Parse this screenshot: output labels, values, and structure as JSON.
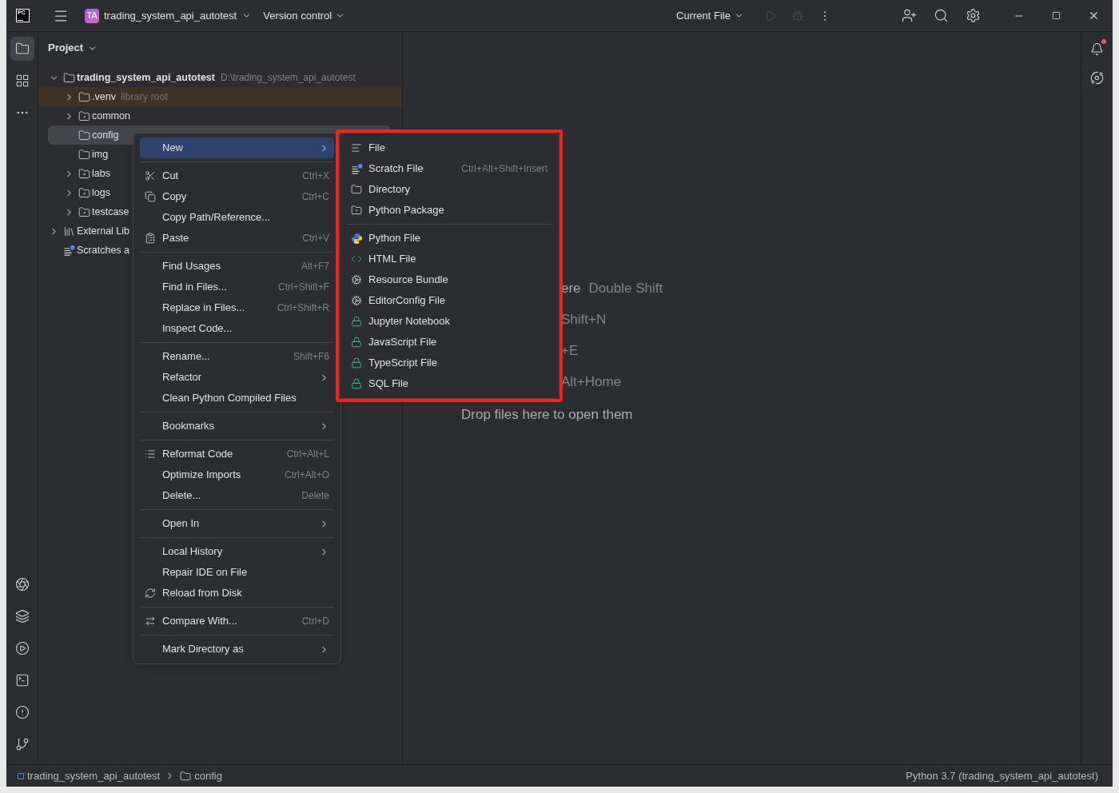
{
  "title_bar": {
    "logo": "PC",
    "project_badge": "TA",
    "project_name": "trading_system_api_autotest",
    "vcs": "Version control",
    "run_config": "Current File",
    "actions": [
      {
        "kind": "run",
        "disabled": true
      },
      {
        "kind": "debug",
        "disabled": true
      },
      {
        "kind": "more",
        "disabled": false
      }
    ],
    "tools": [
      {
        "kind": "add-user"
      },
      {
        "kind": "search"
      },
      {
        "kind": "settings"
      }
    ]
  },
  "left_toolbar": {
    "top": [
      {
        "kind": "project",
        "selected": true
      },
      {
        "kind": "structure",
        "selected": false
      },
      {
        "kind": "more",
        "selected": false
      }
    ],
    "bottom": [
      {
        "kind": "python-console",
        "selected": false
      },
      {
        "kind": "packages",
        "selected": false
      },
      {
        "kind": "services",
        "selected": false
      },
      {
        "kind": "terminal",
        "selected": false
      },
      {
        "kind": "problems",
        "selected": false
      },
      {
        "kind": "git",
        "selected": false
      }
    ]
  },
  "project_panel": {
    "title": "Project",
    "tree": [
      {
        "name": "trading_system_api_autotest",
        "path": "D:\\trading_system_api_autotest",
        "kind": "root",
        "expanded": true,
        "selected": false,
        "children": [
          {
            "name": ".venv",
            "hint": "library root",
            "kind": "library",
            "expanded": false,
            "selected": false
          },
          {
            "name": "common",
            "kind": "package",
            "expanded": false,
            "selected": false
          },
          {
            "name": "config",
            "kind": "folder",
            "selected": true
          },
          {
            "name": "img",
            "kind": "folder",
            "selected": false
          },
          {
            "name": "labs",
            "kind": "package",
            "expanded": false,
            "selected": false
          },
          {
            "name": "logs",
            "kind": "package",
            "expanded": false,
            "selected": false
          },
          {
            "name": "testcase",
            "kind": "package",
            "expanded": false,
            "selected": false
          }
        ]
      },
      {
        "name": "External Lib",
        "kind": "libraries",
        "expanded": false,
        "selected": false
      },
      {
        "name": "Scratches a",
        "kind": "scratches",
        "selected": false
      }
    ]
  },
  "editor": {
    "hints": [
      {
        "action": "ere",
        "shortcut": "Double Shift"
      },
      {
        "shortcut": "Shift+N"
      },
      {
        "shortcut": "+E"
      },
      {
        "shortcut": "Alt+Home"
      }
    ],
    "drop_text": "Drop files here to open them"
  },
  "context_menu": {
    "groups": [
      [
        {
          "label": "New",
          "submenu": true,
          "selected": true
        }
      ],
      [
        {
          "label": "Cut",
          "shortcut": "Ctrl+X",
          "kind": "cut",
          "selected": false
        },
        {
          "label": "Copy",
          "shortcut": "Ctrl+C",
          "kind": "copy",
          "selected": false
        },
        {
          "label": "Copy Path/Reference...",
          "selected": false
        },
        {
          "label": "Paste",
          "shortcut": "Ctrl+V",
          "kind": "paste",
          "selected": false
        }
      ],
      [
        {
          "label": "Find Usages",
          "shortcut": "Alt+F7",
          "selected": false
        },
        {
          "label": "Find in Files...",
          "shortcut": "Ctrl+Shift+F",
          "selected": false
        },
        {
          "label": "Replace in Files...",
          "shortcut": "Ctrl+Shift+R",
          "selected": false
        },
        {
          "label": "Inspect Code...",
          "selected": false
        }
      ],
      [
        {
          "label": "Rename...",
          "shortcut": "Shift+F6",
          "selected": false
        },
        {
          "label": "Refactor",
          "submenu": true,
          "selected": false
        },
        {
          "label": "Clean Python Compiled Files",
          "selected": false
        }
      ],
      [
        {
          "label": "Bookmarks",
          "submenu": true,
          "selected": false
        }
      ],
      [
        {
          "label": "Reformat Code",
          "shortcut": "Ctrl+Alt+L",
          "kind": "reformat",
          "selected": false
        },
        {
          "label": "Optimize Imports",
          "shortcut": "Ctrl+Alt+O",
          "selected": false
        },
        {
          "label": "Delete...",
          "shortcut": "Delete",
          "selected": false
        }
      ],
      [
        {
          "label": "Open In",
          "submenu": true,
          "selected": false
        }
      ],
      [
        {
          "label": "Local History",
          "submenu": true,
          "selected": false
        },
        {
          "label": "Repair IDE on File",
          "selected": false
        },
        {
          "label": "Reload from Disk",
          "kind": "reload",
          "selected": false
        }
      ],
      [
        {
          "label": "Compare With...",
          "shortcut": "Ctrl+D",
          "kind": "compare",
          "selected": false
        }
      ],
      [
        {
          "label": "Mark Directory as",
          "submenu": true,
          "selected": false
        }
      ]
    ]
  },
  "new_submenu": {
    "groups": [
      [
        {
          "label": "File",
          "kind": "file"
        },
        {
          "label": "Scratch File",
          "shortcut": "Ctrl+Alt+Shift+Insert",
          "kind": "scratch"
        },
        {
          "label": "Directory",
          "kind": "folder"
        },
        {
          "label": "Python Package",
          "kind": "package"
        }
      ],
      [
        {
          "label": "Python File",
          "kind": "python"
        },
        {
          "label": "HTML File",
          "kind": "html"
        },
        {
          "label": "Resource Bundle",
          "kind": "gear"
        },
        {
          "label": "EditorConfig File",
          "kind": "gear"
        },
        {
          "label": "Jupyter Notebook",
          "kind": "lock"
        },
        {
          "label": "JavaScript File",
          "kind": "lock"
        },
        {
          "label": "TypeScript File",
          "kind": "lock"
        },
        {
          "label": "SQL File",
          "kind": "lock"
        }
      ]
    ]
  },
  "right_toolbar": [
    {
      "kind": "notifications",
      "badge": true
    },
    {
      "kind": "ai-assistant",
      "badge": false
    }
  ],
  "status_bar": {
    "breadcrumbs": [
      {
        "label": "trading_system_api_autotest",
        "kind": "module"
      },
      {
        "label": "config",
        "kind": "folder"
      }
    ],
    "interpreter": "Python 3.7 (trading_system_api_autotest)"
  }
}
